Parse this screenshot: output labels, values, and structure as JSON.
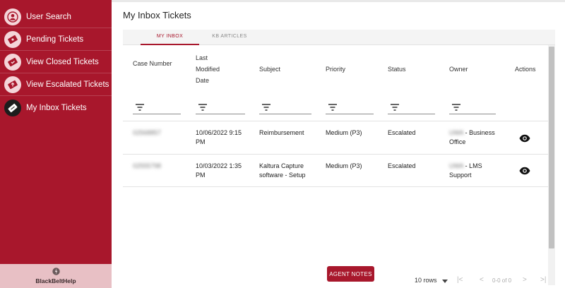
{
  "sidebar": {
    "items": [
      {
        "label": "User Search",
        "icon": "user-circle-icon",
        "active": false
      },
      {
        "label": "Pending Tickets",
        "icon": "ticket-pending-icon",
        "active": false
      },
      {
        "label": "View Closed Tickets",
        "icon": "ticket-closed-icon",
        "active": false
      },
      {
        "label": "View Escalated Tickets",
        "icon": "ticket-escalated-icon",
        "active": false
      },
      {
        "label": "My Inbox Tickets",
        "icon": "ticket-inbox-icon",
        "active": true
      }
    ],
    "brand": "BlackBeltHelp"
  },
  "page": {
    "title": "My Inbox Tickets"
  },
  "tabs": [
    {
      "label": "MY INBOX",
      "active": true
    },
    {
      "label": "KB ARTICLES",
      "active": false
    }
  ],
  "table": {
    "columns": [
      "Case Number",
      "Last Modified Date",
      "Subject",
      "Priority",
      "Status",
      "Owner",
      "Actions"
    ],
    "rows": [
      {
        "case_number": "02568857",
        "modified": "10/06/2022 9:15 PM",
        "subject": "Reimbursement",
        "priority": "Medium (P3)",
        "status": "Escalated",
        "owner_prefix": "UWA",
        "owner_suffix": " - Business Office"
      },
      {
        "case_number": "02555798",
        "modified": "10/03/2022 1:35 PM",
        "subject": "Kaltura Capture software - Setup",
        "priority": "Medium (P3)",
        "status": "Escalated",
        "owner_prefix": "UWA",
        "owner_suffix": " - LMS Support"
      }
    ]
  },
  "footer": {
    "agent_notes": "AGENT NOTES",
    "rows_per_page": "10 rows",
    "range": "0-0 of 0"
  },
  "colors": {
    "brand": "#a8172c",
    "sidebar_bg": "#a8172c",
    "brand_footer_bg": "#e8c0c5"
  }
}
